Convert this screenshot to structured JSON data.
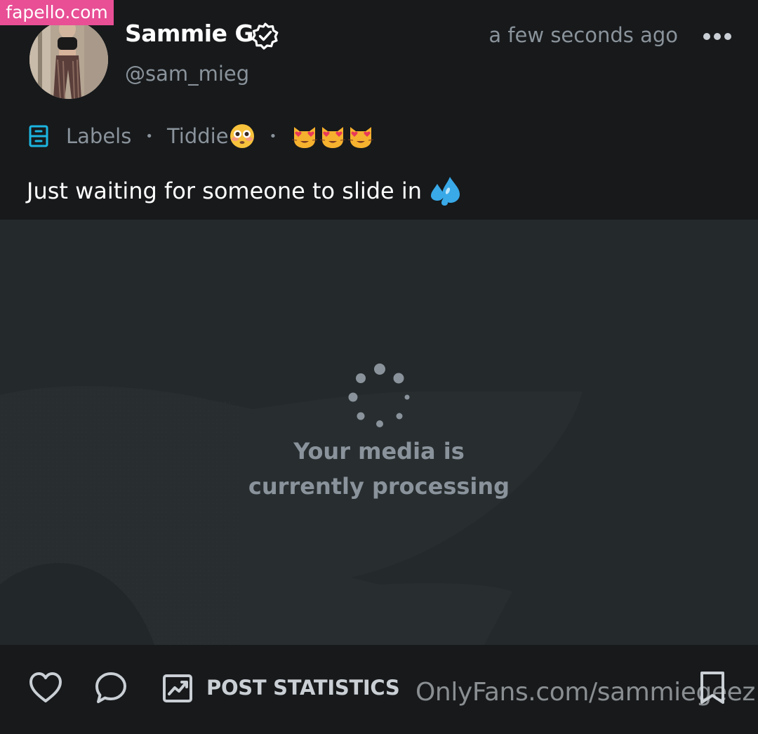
{
  "watermark_top": "fapello.com",
  "post": {
    "author_name": "Sammie G",
    "author_handle": "@sam_mieg",
    "timestamp": "a few seconds ago",
    "labels_text": "Labels",
    "label_tag": "Tiddie",
    "caption": "Just waiting for someone to slide in",
    "media_status": "Your media is currently processing"
  },
  "footer": {
    "post_statistics_label": "POST STATISTICS"
  },
  "watermark_bottom": "OnlyFans.com/sammiegeez",
  "colors": {
    "background": "#17191b",
    "media_background": "#24292b",
    "accent": "#1cb5e0",
    "muted_text": "#8a939b",
    "watermark_pink": "#e84f95"
  },
  "icons": [
    "verified-badge-icon",
    "more-options-icon",
    "labels-icon",
    "heart-icon",
    "comment-icon",
    "post-statistics-icon",
    "bookmark-icon",
    "loading-spinner-icon"
  ]
}
